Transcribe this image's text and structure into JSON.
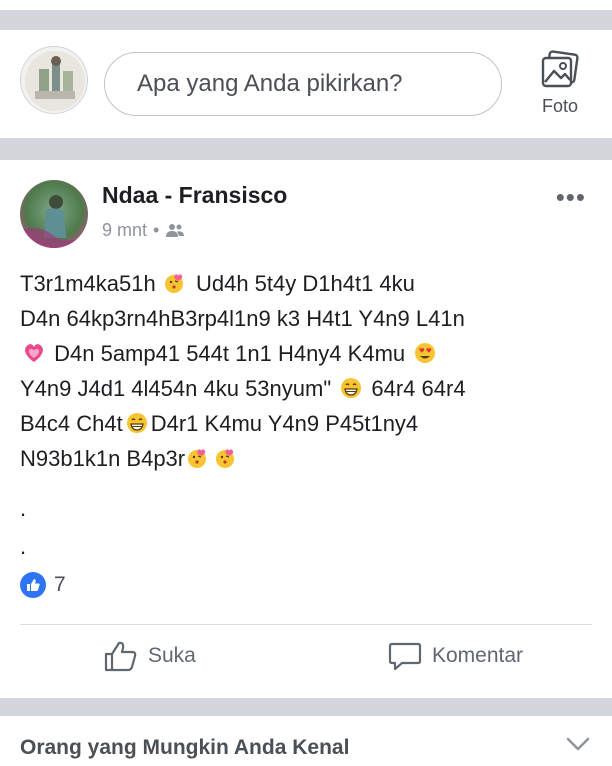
{
  "composer": {
    "placeholder": "Apa yang Anda pikirkan?",
    "photo_label": "Foto"
  },
  "post": {
    "author": "Ndaa - Fransisco",
    "time": "9 mnt",
    "dot": "•",
    "audience_icon": "friends-icon",
    "text_segments": [
      [
        "T3r1m4ka51h ",
        "emoji:kissing-heart-face",
        " Ud4h 5t4y D1h4t1 4ku"
      ],
      [
        "D4n 64kp3rn4hB3rp4l1n9 k3 H4t1 Y4n9 L41n"
      ],
      [
        "emoji:growing-heart",
        " D4n 5amp41 544t 1n1 H4ny4 K4mu ",
        "emoji:heart-eyes-face"
      ],
      [
        "Y4n9 J4d1 4l454n 4ku  53nyum\" ",
        "emoji:grinning-face",
        " 64r4 64r4"
      ],
      [
        "B4c4 Ch4t",
        "emoji:grinning-face",
        "D4r1 K4mu Y4n9 P45t1ny4"
      ],
      [
        "N93b1k1n B4p3r",
        "emoji:kissing-heart-face",
        "emoji:kissing-heart-face"
      ]
    ],
    "dots": [
      ".",
      "."
    ],
    "like_count": "7",
    "like_label": "Suka",
    "comment_label": "Komentar"
  },
  "suggestions": {
    "title": "Orang yang Mungkin Anda Kenal"
  },
  "colors": {
    "like_blue": "#2e74f5",
    "separator": "#d3d6db",
    "muted_text": "#90949c"
  }
}
